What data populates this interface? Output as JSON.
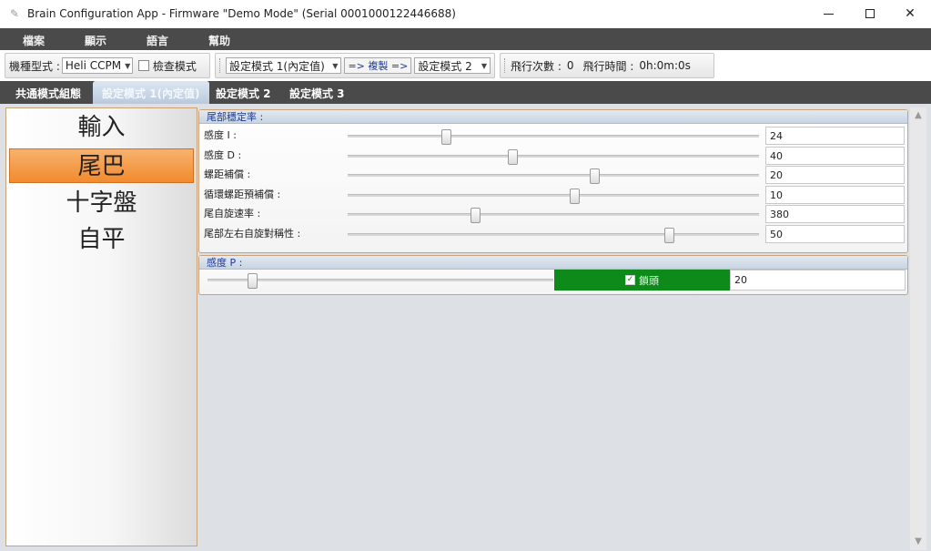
{
  "window": {
    "title": "Brain Configuration App - Firmware \"Demo Mode\" (Serial 0001000122446688)"
  },
  "menu": {
    "items": [
      "檔案",
      "顯示",
      "語言",
      "幫助"
    ]
  },
  "toolbar": {
    "model_label": "機種型式 :",
    "model_value": "Heli CCPM",
    "check_mode_label": "檢查模式",
    "source_profile": "設定模式 1(內定值)",
    "copy_label": "=> 複製 =>",
    "target_profile": "設定模式 2",
    "flight_count_label": "飛行次數 :",
    "flight_count": "0",
    "flight_time_label": "飛行時間 :",
    "flight_time": "0h:0m:0s"
  },
  "tabs": [
    "共通模式組態",
    "設定模式 1(內定值)",
    "設定模式 2",
    "設定模式 3"
  ],
  "active_tab": 1,
  "nav": {
    "items": [
      "輸入",
      "尾巴",
      "十字盤",
      "自平"
    ],
    "selected": 1
  },
  "tail_group": {
    "title": "尾部穩定率 :",
    "rows": [
      {
        "label": "感度 I :",
        "value": "24",
        "level": 0.24
      },
      {
        "label": "感度 D :",
        "value": "40",
        "level": 0.4
      },
      {
        "label": "螺距補償 :",
        "value": "20",
        "level": 0.6
      },
      {
        "label": "循環螺距預補償 :",
        "value": "10",
        "level": 0.55
      },
      {
        "label": "尾自旋速率 :",
        "value": "380",
        "level": 0.31
      },
      {
        "label": "尾部左右自旋對稱性 :",
        "value": "50",
        "level": 0.78
      }
    ]
  },
  "gain_group": {
    "title": "感度 P :",
    "lock_label": "鎖頭",
    "value": "20",
    "level": 0.13
  },
  "colors": {
    "menu_bg": "#4a4a4a",
    "selected_nav": "#f28a2e",
    "lock_green": "#0e8a1a",
    "header_text": "#1f3a8f"
  }
}
